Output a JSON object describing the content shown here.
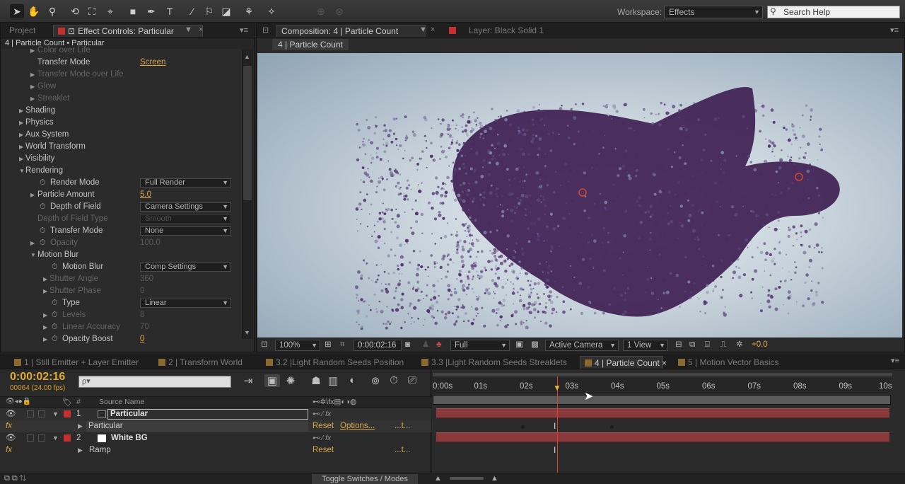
{
  "toolbar": {
    "workspace_label": "Workspace:",
    "workspace_value": "Effects",
    "search_placeholder": "Search Help"
  },
  "effect_panel": {
    "tab_project": "Project",
    "tab_effect_controls": "Effect Controls: Particular",
    "header": "4 | Particle Count • Particular",
    "rows": [
      {
        "label": "Color over Life",
        "dim": true
      },
      {
        "label": "Transfer Mode",
        "value": "Screen"
      },
      {
        "label": "Transfer Mode over Life",
        "dim": true
      },
      {
        "label": "Glow",
        "dim": true
      },
      {
        "label": "Streaklet",
        "dim": true
      },
      {
        "label": "Shading"
      },
      {
        "label": "Physics"
      },
      {
        "label": "Aux System"
      },
      {
        "label": "World Transform"
      },
      {
        "label": "Visibility"
      },
      {
        "label": "Rendering"
      },
      {
        "label": "Render Mode",
        "value": "Full Render"
      },
      {
        "label": "Particle Amount",
        "value": "5.0"
      },
      {
        "label": "Depth of Field",
        "value": "Camera Settings"
      },
      {
        "label": "Depth of Field Type",
        "value": "Smooth",
        "dim": true
      },
      {
        "label": "Transfer Mode",
        "value": "None"
      },
      {
        "label": "Opacity",
        "value": "100.0",
        "dim": true
      },
      {
        "label": "Motion Blur"
      },
      {
        "label": "Motion Blur",
        "value": "Comp Settings"
      },
      {
        "label": "Shutter Angle",
        "value": "360",
        "dim": true
      },
      {
        "label": "Shutter Phase",
        "value": "0",
        "dim": true
      },
      {
        "label": "Type",
        "value": "Linear"
      },
      {
        "label": "Levels",
        "value": "8",
        "dim": true
      },
      {
        "label": "Linear Accuracy",
        "value": "70",
        "dim": true
      },
      {
        "label": "Opacity Boost",
        "value": "0"
      }
    ]
  },
  "comp_panel": {
    "tab_composition": "Composition: 4 | Particle Count",
    "tab_layer": "Layer: Black Solid 1",
    "sub_tab": "4 | Particle Count",
    "footer": {
      "zoom": "100%",
      "timecode": "0:00:02:16",
      "resolution": "Full",
      "camera": "Active Camera",
      "view": "1 View",
      "exposure": "+0.0"
    }
  },
  "timeline": {
    "tabs": [
      "1 | Still Emitter + Layer Emitter",
      "2 | Transform World",
      "3.2 |Light Random Seeds Position",
      "3.3 |Light Random Seeds Streaklets",
      "4 | Particle Count",
      "5 | Motion Vector Basics"
    ],
    "timecode": "0:00:02:16",
    "frame_info": "00064 (24.00 fps)",
    "search_placeholder": "ρ▾",
    "source_name_header": "Source Name",
    "layers": [
      {
        "num": "1",
        "name": "Particular"
      },
      {
        "effect": "Particular",
        "reset": "Reset",
        "options": "Options...",
        "more": "...t..."
      },
      {
        "num": "2",
        "name": "White BG"
      },
      {
        "effect": "Ramp",
        "reset": "Reset",
        "more": "...t..."
      }
    ],
    "ruler_ticks": [
      "0:00s",
      "01s",
      "02s",
      "03s",
      "04s",
      "05s",
      "06s",
      "07s",
      "08s",
      "09s",
      "10s"
    ],
    "toggle_label": "Toggle Switches / Modes"
  }
}
